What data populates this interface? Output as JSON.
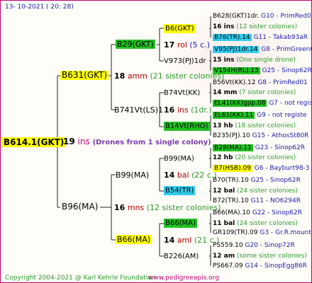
{
  "header": {
    "date": "13- 10-2021 ( 20: 28)"
  },
  "root": {
    "name": "B614.1(GKT)",
    "count": "19",
    "unit": "ins",
    "note": "(Drones from 1 single colony)"
  },
  "gen1": [
    {
      "name": "B631(GKT)",
      "count": "18",
      "unit": "amm",
      "note": "(21 sister colonies)"
    },
    {
      "name": "B96(MA)",
      "count": "16",
      "unit": "mns",
      "note": "(12 sister colonies)"
    }
  ],
  "gen2": [
    {
      "name": "B29(GKT)",
      "count": "17",
      "unit": "rol",
      "note": "(5 c.)"
    },
    {
      "name": "B741Vt(LS)1",
      "count": "16",
      "unit": "ins",
      "note": "(1dr.)"
    },
    {
      "name": "B99(MA)",
      "count": "14",
      "unit": "bal",
      "note": "(22 c.)"
    },
    {
      "name": "B66(MA)",
      "count": "14",
      "unit": "aml",
      "note": "(21 c.)"
    }
  ],
  "gen3": [
    {
      "name": "B6(GKT)",
      "count": "17",
      "unit": "rol",
      "note": "(5 c.)"
    },
    {
      "name": "V973(PJ)1dr",
      "count": "",
      "unit": "",
      "note": ""
    },
    {
      "name": "B74Vt(KK)",
      "count": "14",
      "unit": "mm",
      "note": ""
    },
    {
      "name": "B14Vt(RHO)",
      "count": "",
      "unit": "",
      "note": ""
    },
    {
      "name": "B99(MA)",
      "count": "12",
      "unit": "bal",
      "note": ""
    },
    {
      "name": "B54(TR)",
      "count": "",
      "unit": "",
      "note": ""
    },
    {
      "name": "B66(MA)",
      "count": "11",
      "unit": "bal",
      "note": ""
    },
    {
      "name": "B226(AM)",
      "count": "12",
      "unit": "am",
      "note": ""
    }
  ],
  "gen4": [
    {
      "name": "B628(GKT)1dr.",
      "code": "G10 - PrimRed01"
    },
    {
      "name": "16 ins",
      "note": "(12 sister colonies)"
    },
    {
      "name": "B76(TR).14",
      "code": "G11 - Takab93aR"
    },
    {
      "name": "V95(PJ)1dr.14",
      "code": "G8 - PrimGreen00"
    },
    {
      "name": "15 ins",
      "note": "(One single drone)"
    },
    {
      "name": "V154H(RL).13",
      "code": "G25 - Sinop62R"
    },
    {
      "name": "B56Vt(KK).12",
      "code": "G8 - PrimRed01"
    },
    {
      "name": "14 mm",
      "note": "(7 sister colonies)"
    },
    {
      "name": "EL41(KK)gpp.08",
      "code": "G7 - not registe"
    },
    {
      "name": "EL61(KK).11",
      "code": "G9 - not registe"
    },
    {
      "name": "13 hb",
      "note": "(18 sister colonies)"
    },
    {
      "name": "B235(PJ).10",
      "code": "G15 - AthosSt80R"
    },
    {
      "name": "B28(MA).11",
      "code": "G23 - Sinop62R"
    },
    {
      "name": "12 hb",
      "note": "(20 sister colonies)"
    },
    {
      "name": "B7(HSB).09",
      "code": "G6 - Bayburt98-3"
    },
    {
      "name": "B70(TR).10",
      "code": "G25 - Sinop62R"
    },
    {
      "name": "12 bal",
      "note": "(24 sister colonies)"
    },
    {
      "name": "B72(TR).10",
      "code": "G11 - NO6294R"
    },
    {
      "name": "B66(MA).10",
      "code": "G22 - Sinop62R"
    },
    {
      "name": "11 bal",
      "note": "(24 sister colonies)"
    },
    {
      "name": "GR109(TR).09",
      "code": "G3 - Gr.R.mounta"
    },
    {
      "name": "PS559.10",
      "code": "G20 - Sinop72R"
    },
    {
      "name": "12 am",
      "note": "(some sister colonies)"
    },
    {
      "name": "PS667.09",
      "code": "G14 - SinopEgg86R"
    }
  ],
  "footer": {
    "copyright": "Copyright 2004-2021 @ Karl Kehrle Foundation",
    "url": "www.pedigreeapis.org"
  }
}
